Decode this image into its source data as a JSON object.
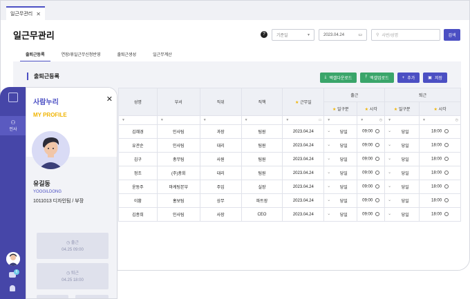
{
  "window": {
    "tab_label": "일근무관리",
    "tab_close": "✕",
    "page_title": "일근무관리",
    "help": "?",
    "filter_select": "기준일",
    "date_value": "2023.04.24",
    "search_placeholder": "사번/성명",
    "search_button": "검색"
  },
  "subtabs": [
    {
      "label": "출퇴근등록"
    },
    {
      "label": "연장/휴일근무신청반영"
    },
    {
      "label": "출퇴근생성"
    },
    {
      "label": "일근무계산"
    }
  ],
  "section": {
    "title": "출퇴근등록",
    "buttons": {
      "excel_download": "엑셀다운로드",
      "excel_upload": "엑셀업로드",
      "add": "추가",
      "save": "저장"
    }
  },
  "table": {
    "headers": {
      "name": "성명",
      "dept": "부서",
      "grade": "직위",
      "role": "직책",
      "work_date": "근무일",
      "in": "출근",
      "out": "퇴근",
      "in_day": "일구분",
      "in_time": "시각",
      "out_day": "일구분",
      "out_time": "시각"
    },
    "rows": [
      {
        "name": "김혜경",
        "dept": "인사팀",
        "grade": "과장",
        "role": "팀원",
        "date": "2023.04.24",
        "in_day": "당일",
        "in_time": "09:00",
        "out_day": "당일",
        "out_time": "18:00"
      },
      {
        "name": "유관순",
        "dept": "인사팀",
        "grade": "대리",
        "role": "팀원",
        "date": "2023.04.24",
        "in_day": "당일",
        "in_time": "09:00",
        "out_day": "당일",
        "out_time": "18:00"
      },
      {
        "name": "김구",
        "dept": "총무팀",
        "grade": "사원",
        "role": "팀원",
        "date": "2023.04.24",
        "in_day": "당일",
        "in_time": "09:00",
        "out_day": "당일",
        "out_time": "18:00"
      },
      {
        "name": "정조",
        "dept": "(주)총회",
        "grade": "대리",
        "role": "팀원",
        "date": "2023.04.24",
        "in_day": "당일",
        "in_time": "09:00",
        "out_day": "당일",
        "out_time": "18:00"
      },
      {
        "name": "윤동주",
        "dept": "마케팅본부",
        "grade": "주임",
        "role": "실장",
        "date": "2023.04.24",
        "in_day": "당일",
        "in_time": "09:00",
        "out_day": "당일",
        "out_time": "18:00"
      },
      {
        "name": "이황",
        "dept": "홍보팀",
        "grade": "상무",
        "role": "파트장",
        "date": "2023.04.24",
        "in_day": "당일",
        "in_time": "09:00",
        "out_day": "당일",
        "out_time": "18:00"
      },
      {
        "name": "김종희",
        "dept": "인사팀",
        "grade": "사장",
        "role": "CEO",
        "date": "2023.04.24",
        "in_day": "당일",
        "in_time": "09:00",
        "out_day": "당일",
        "out_time": "18:00"
      }
    ]
  },
  "sidebar": {
    "item_label": "인사",
    "chat_badge": "6"
  },
  "profile": {
    "brand": "사람누리",
    "close": "✕",
    "heading": "MY PROFILE",
    "name": "유길동",
    "name_en": "YOOGILDONG",
    "info": "1011013 디자인팀 / 부장",
    "clock_in_label": "출근",
    "clock_in_time": "04.25 09:00",
    "clock_out_label": "퇴근",
    "clock_out_time": "04.25 18:00"
  },
  "colors": {
    "accent": "#4b4fc3",
    "sidebar": "#4646a8",
    "green": "#3aa56a",
    "yellow": "#f0b400"
  }
}
